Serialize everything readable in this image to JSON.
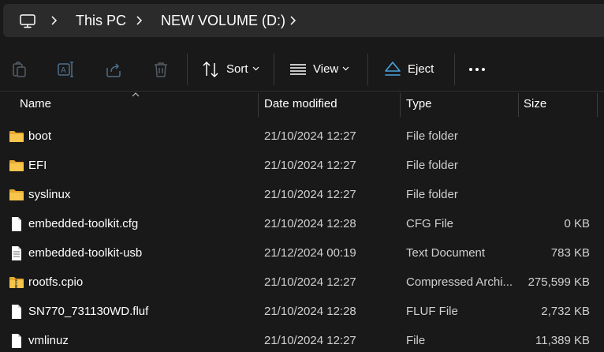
{
  "breadcrumb": {
    "items": [
      "This PC",
      "NEW VOLUME (D:)"
    ]
  },
  "toolbar": {
    "sort_label": "Sort",
    "view_label": "View",
    "eject_label": "Eject",
    "icons": [
      "copy-icon",
      "rename-icon",
      "share-icon",
      "delete-icon",
      "sort-icon",
      "view-icon",
      "eject-icon",
      "more-icon"
    ],
    "accent_color": "#4aa3df"
  },
  "columns": {
    "name": "Name",
    "date": "Date modified",
    "type": "Type",
    "size": "Size"
  },
  "files": [
    {
      "name": "boot",
      "date": "21/10/2024 12:27",
      "type": "File folder",
      "size": "",
      "icon": "folder-icon"
    },
    {
      "name": "EFI",
      "date": "21/10/2024 12:27",
      "type": "File folder",
      "size": "",
      "icon": "folder-icon"
    },
    {
      "name": "syslinux",
      "date": "21/10/2024 12:27",
      "type": "File folder",
      "size": "",
      "icon": "folder-icon"
    },
    {
      "name": "embedded-toolkit.cfg",
      "date": "21/10/2024 12:28",
      "type": "CFG File",
      "size": "0 KB",
      "icon": "file-icon"
    },
    {
      "name": "embedded-toolkit-usb",
      "date": "21/12/2024 00:19",
      "type": "Text Document",
      "size": "783 KB",
      "icon": "text-file-icon"
    },
    {
      "name": "rootfs.cpio",
      "date": "21/10/2024 12:27",
      "type": "Compressed Archi...",
      "size": "275,599 KB",
      "icon": "zip-folder-icon"
    },
    {
      "name": "SN770_731130WD.fluf",
      "date": "21/10/2024 12:28",
      "type": "FLUF File",
      "size": "2,732 KB",
      "icon": "file-icon"
    },
    {
      "name": "vmlinuz",
      "date": "21/10/2024 12:27",
      "type": "File",
      "size": "11,389 KB",
      "icon": "file-icon"
    }
  ],
  "colors": {
    "background": "#191919",
    "crumb_bar": "#2b2b2b",
    "folder": "#f7c44c"
  }
}
